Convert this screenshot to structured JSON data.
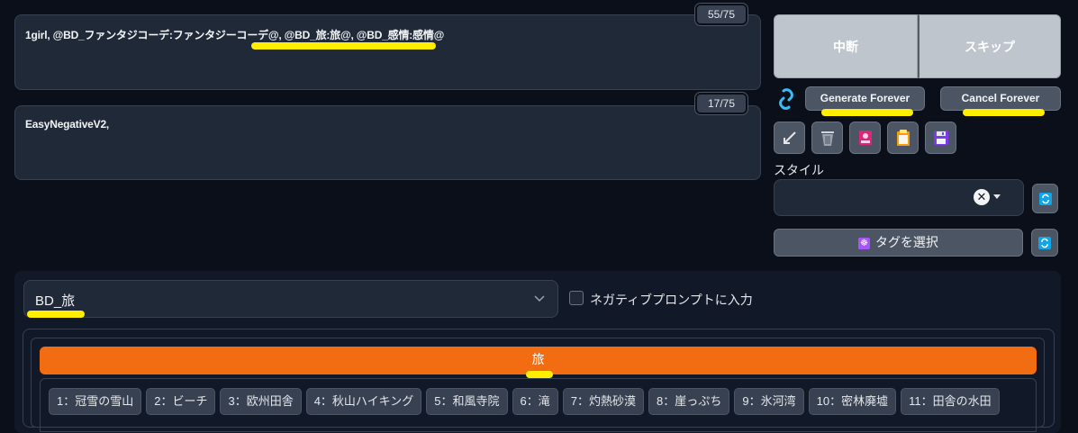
{
  "prompt": {
    "text": "1girl, @BD_ファンタジコーデ:ファンタジーコーデ@, @BD_旅:旅@, @BD_感情:感情@",
    "token_counter": "55/75"
  },
  "negative_prompt": {
    "text": "EasyNegativeV2,",
    "token_counter": "17/75"
  },
  "actions": {
    "interrupt_label": "中断",
    "skip_label": "スキップ",
    "generate_forever_label": "Generate Forever",
    "cancel_forever_label": "Cancel Forever"
  },
  "tools": [
    "arrow-icon",
    "trash-icon",
    "image-icon",
    "clipboard-icon",
    "save-icon"
  ],
  "styles": {
    "label": "スタイル",
    "value": ""
  },
  "tag_select": {
    "label": "タグを選択",
    "icon": "☸"
  },
  "category": {
    "selected": "BD_旅",
    "negative_checkbox_label": "ネガティブプロンプトに入力",
    "negative_checked": false
  },
  "group": {
    "title": "旅",
    "tags": [
      "1：冠雪の雪山",
      "2：ビーチ",
      "3：欧州田舎",
      "4：秋山ハイキング",
      "5：和風寺院",
      "6：滝",
      "7：灼熱砂漠",
      "8：崖っぷち",
      "9：氷河湾",
      "10：密林廃墟",
      "11：田舎の水田"
    ]
  },
  "colors": {
    "background": "#0b0f19",
    "highlight": "#ffee00",
    "orange_header": "#f26d12",
    "link_blue": "#38bdf8"
  }
}
